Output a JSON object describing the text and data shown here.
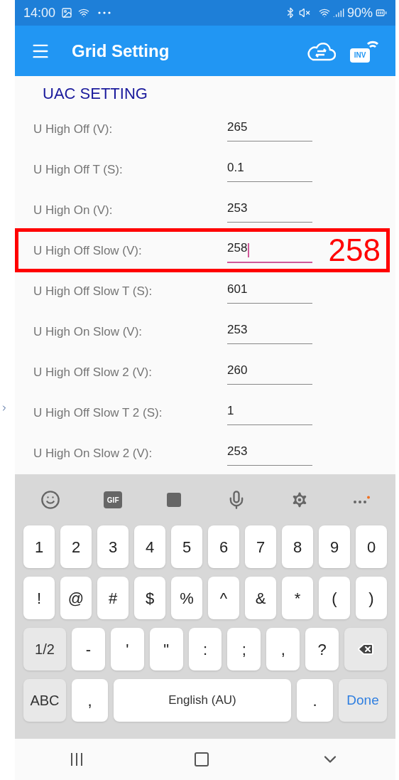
{
  "status_bar": {
    "time": "14:00",
    "battery": "90%"
  },
  "app_bar": {
    "title": "Grid Setting",
    "device_badge": "INV"
  },
  "section": {
    "title": "UAC SETTING"
  },
  "rows": [
    {
      "label": "U High Off (V):",
      "value": "265",
      "focused": false
    },
    {
      "label": "U High Off T (S):",
      "value": "0.1",
      "focused": false
    },
    {
      "label": "U High On (V):",
      "value": "253",
      "focused": false
    },
    {
      "label": "U High Off Slow (V):",
      "value": "258",
      "focused": true,
      "annotation": "258"
    },
    {
      "label": "U High Off Slow T (S):",
      "value": "601",
      "focused": false
    },
    {
      "label": "U High On Slow (V):",
      "value": "253",
      "focused": false
    },
    {
      "label": "U High Off Slow 2 (V):",
      "value": "260",
      "focused": false
    },
    {
      "label": "U High Off Slow T 2 (S):",
      "value": "1",
      "focused": false
    },
    {
      "label": "U High On Slow 2 (V):",
      "value": "253",
      "focused": false
    }
  ],
  "keyboard": {
    "gif_label": "GIF",
    "number_row": [
      {
        "kind": "key",
        "label": "1"
      },
      {
        "kind": "key",
        "label": "2"
      },
      {
        "kind": "key",
        "label": "3"
      },
      {
        "kind": "key",
        "label": "4"
      },
      {
        "kind": "key",
        "label": "5"
      },
      {
        "kind": "key",
        "label": "6"
      },
      {
        "kind": "key",
        "label": "7"
      },
      {
        "kind": "key",
        "label": "8"
      },
      {
        "kind": "key",
        "label": "9"
      },
      {
        "kind": "key",
        "label": "0"
      }
    ],
    "symbol_row": [
      {
        "kind": "key",
        "label": "!"
      },
      {
        "kind": "key",
        "label": "@"
      },
      {
        "kind": "key",
        "label": "#"
      },
      {
        "kind": "key",
        "label": "$"
      },
      {
        "kind": "key",
        "label": "%"
      },
      {
        "kind": "key",
        "label": "^"
      },
      {
        "kind": "key",
        "label": "&"
      },
      {
        "kind": "key",
        "label": "*"
      },
      {
        "kind": "key",
        "label": "("
      },
      {
        "kind": "key",
        "label": ")"
      }
    ],
    "punctuation_row": [
      {
        "kind": "wide",
        "label": "1/2"
      },
      {
        "kind": "key",
        "label": "-"
      },
      {
        "kind": "key",
        "label": "'"
      },
      {
        "kind": "key",
        "label": "\""
      },
      {
        "kind": "key",
        "label": ":"
      },
      {
        "kind": "key",
        "label": ";"
      },
      {
        "kind": "key",
        "label": ","
      },
      {
        "kind": "key",
        "label": "?"
      },
      {
        "kind": "backspace"
      }
    ],
    "bottom_row": [
      {
        "kind": "wide",
        "label": "ABC"
      },
      {
        "kind": "key",
        "label": ","
      },
      {
        "kind": "space",
        "label": "English (AU)"
      },
      {
        "kind": "key",
        "label": "."
      },
      {
        "kind": "done",
        "label": "Done"
      }
    ]
  }
}
